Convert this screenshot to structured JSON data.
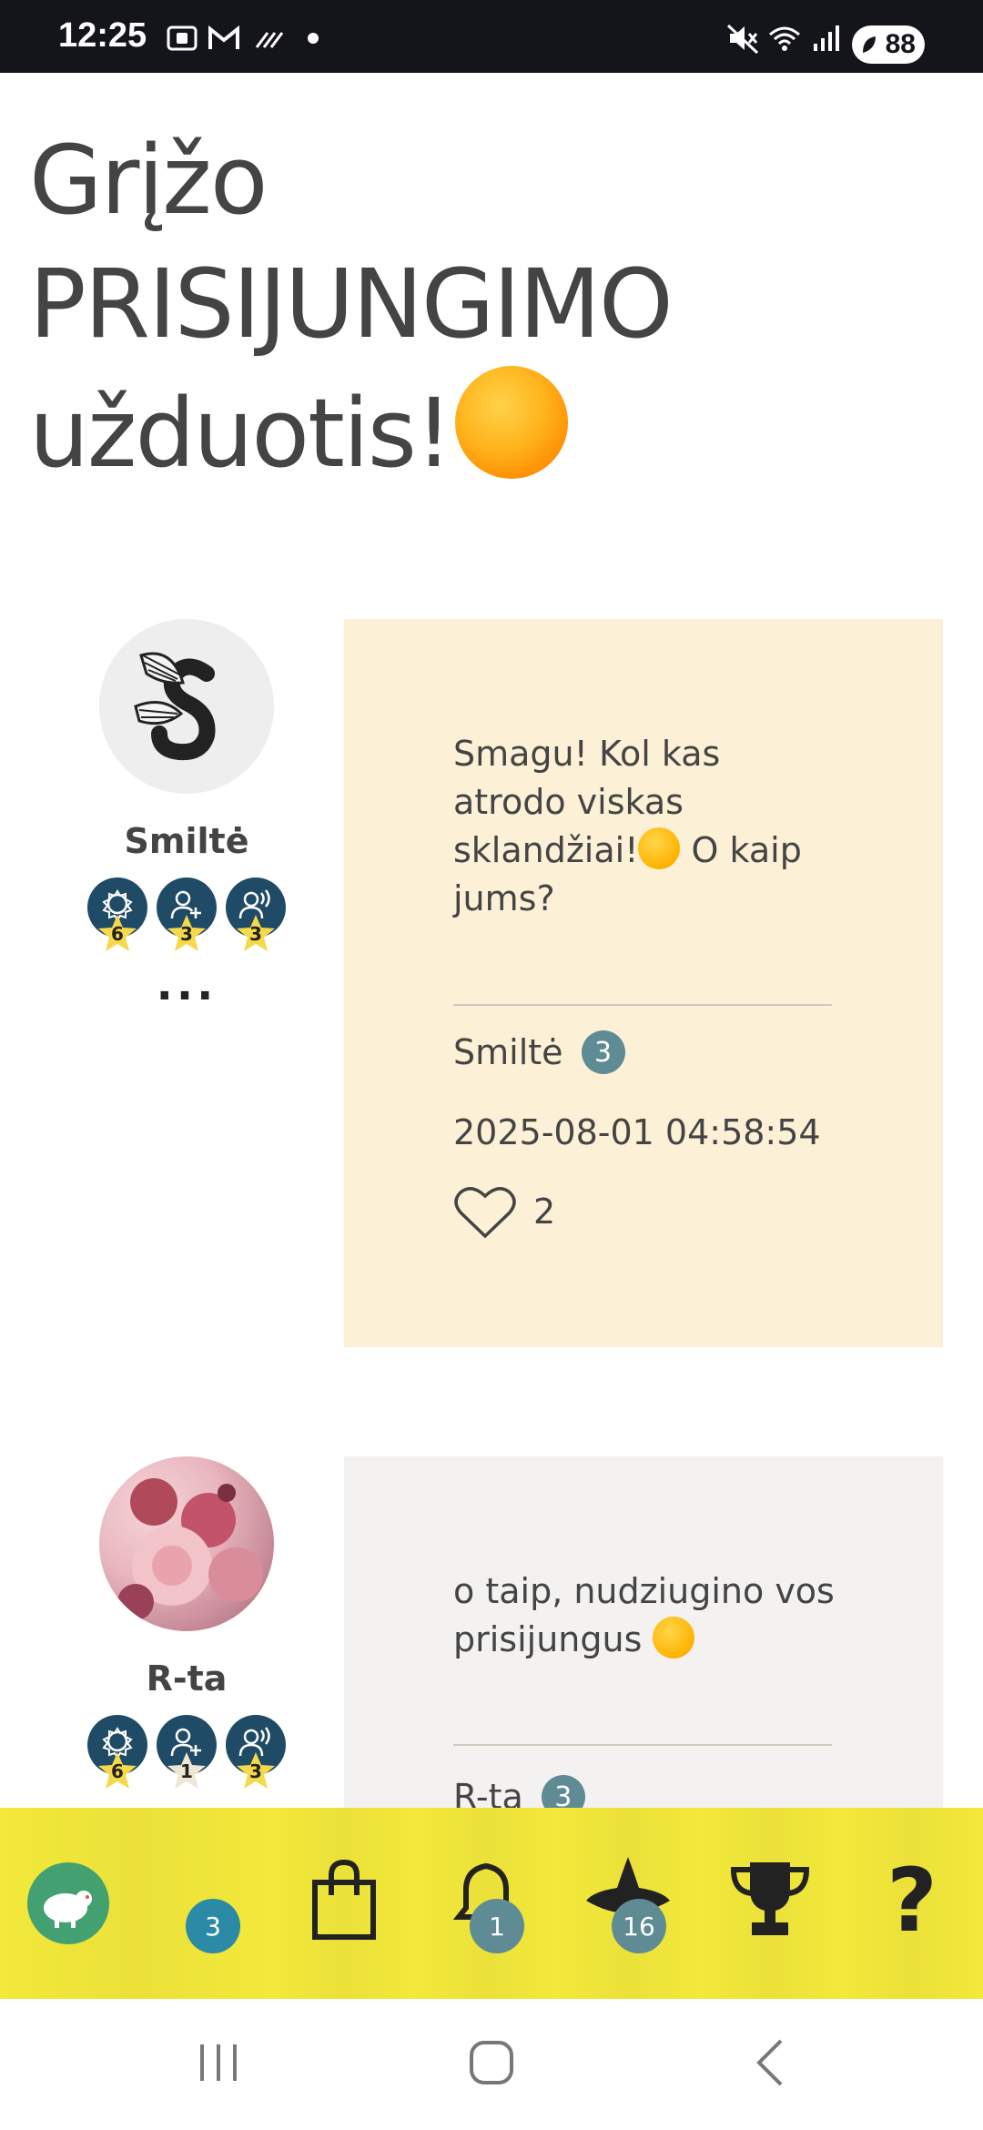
{
  "status_bar": {
    "time": "12:25",
    "battery": "88",
    "left_icons": [
      "screenshot-icon",
      "gmail-icon",
      "data-saver-icon",
      "dot-icon"
    ],
    "right_icons": [
      "mute-icon",
      "wifi-icon",
      "signal-icon"
    ]
  },
  "page": {
    "title_line1": "Grįžo",
    "title_line2": "PRISIJUNGIMO",
    "title_line3": "užduotis!"
  },
  "posts": [
    {
      "author": "Smiltė",
      "badges": [
        "6",
        "3",
        "3"
      ],
      "more": "...",
      "text_before_emoji": "Smagu! Kol kas atrodo viskas sklandžiai!",
      "text_after_emoji": " O kaip jums?",
      "meta_author": "Smiltė",
      "level": "3",
      "date": "2025-08-01 04:58:54",
      "likes": "2",
      "card_color": "#fcf1d6"
    },
    {
      "author": "R-ta",
      "badges": [
        "6",
        "1",
        "3"
      ],
      "text_before_emoji": "o taip, nudziugino vos prisijungus ",
      "meta_author": "R-ta",
      "level": "3",
      "card_color": "#f3f2f1"
    }
  ],
  "bottom_nav": {
    "profile_badge": "3",
    "notifications_badge": "1",
    "points_badge": "16",
    "items": [
      "profile-tab",
      "shop-tab",
      "notifications-tab",
      "points-tab",
      "trophy-tab",
      "help-tab"
    ],
    "help_label": "?",
    "colors": {
      "background": "#f3e93b",
      "badge_teal": "#2b8aa5",
      "badge_gray": "#5f8b95"
    }
  },
  "system_nav": {
    "items": [
      "recent-apps-button",
      "home-button",
      "back-button"
    ]
  }
}
